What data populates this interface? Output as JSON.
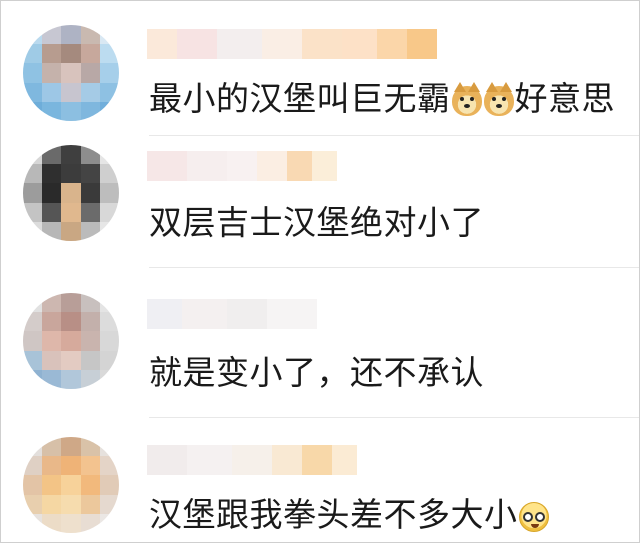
{
  "comments": [
    {
      "text": "最小的汉堡叫巨无霸",
      "text_after": "好意思",
      "emojis": [
        "doge-icon",
        "doge-icon"
      ]
    },
    {
      "text": "双层吉士汉堡绝对小了"
    },
    {
      "text": "就是变小了，还不承认"
    },
    {
      "text": "汉堡跟我拳头差不多大小",
      "emojis": [
        "nerd-face-icon"
      ]
    }
  ],
  "colors": {
    "text": "#1a1a1a",
    "divider": "#e8e8e8",
    "border": "#cfcfcf"
  }
}
